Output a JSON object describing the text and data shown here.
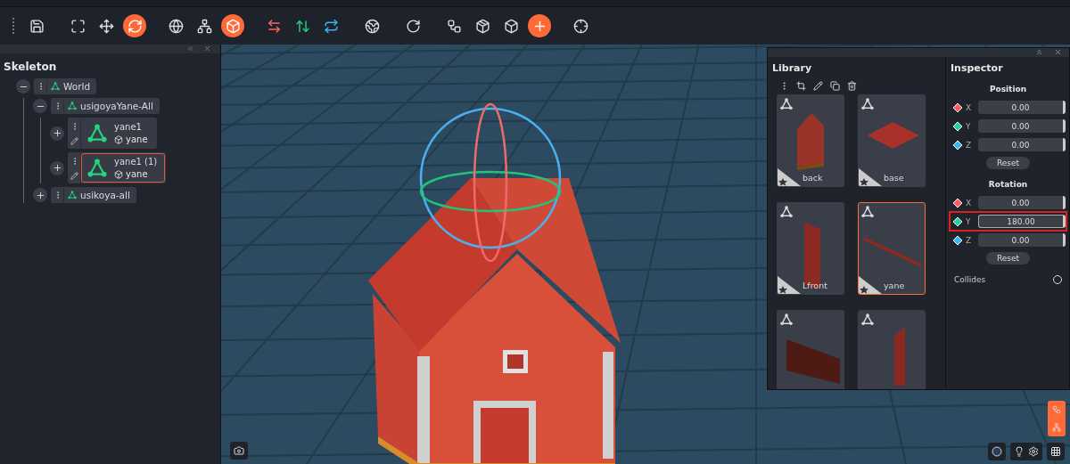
{
  "toolbar": {
    "groups": [
      [
        {
          "active": false
        }
      ],
      [
        {
          "active": false
        },
        {
          "active": false
        },
        {
          "active": true
        }
      ],
      [
        {
          "active": false
        },
        {
          "active": false
        },
        {
          "active": true
        }
      ],
      [
        {
          "active": false
        },
        {
          "active": false
        },
        {
          "active": false
        }
      ],
      [
        {
          "active": false
        }
      ],
      [
        {
          "active": false
        }
      ],
      [
        {
          "active": false
        },
        {
          "active": false
        },
        {
          "active": false
        },
        {
          "active": true
        }
      ],
      [
        {
          "active": false
        }
      ]
    ]
  },
  "skeleton": {
    "title": "Skeleton",
    "tree": [
      {
        "kind": "group",
        "label": "World",
        "expanded": true,
        "selected": false,
        "children": [
          {
            "kind": "group",
            "label": "usigoyaYane-All",
            "expanded": true,
            "selected": false,
            "children": [
              {
                "kind": "model",
                "label": "yane1",
                "model": "yane",
                "expanded": false,
                "selected": false
              },
              {
                "kind": "model",
                "label": "yane1 (1)",
                "model": "yane",
                "expanded": false,
                "selected": true
              }
            ]
          },
          {
            "kind": "group",
            "label": "usikoya-all",
            "expanded": false,
            "selected": false
          }
        ]
      }
    ]
  },
  "library": {
    "title": "Library",
    "items": [
      {
        "label": "back",
        "starred": true,
        "selected": false
      },
      {
        "label": "base",
        "starred": true,
        "selected": false
      },
      {
        "label": "Lfront",
        "starred": true,
        "selected": false
      },
      {
        "label": "yane",
        "starred": true,
        "selected": true
      },
      {
        "starred": false,
        "selected": false
      },
      {
        "starred": false,
        "selected": false
      }
    ]
  },
  "inspector": {
    "title": "Inspector",
    "sections": [
      {
        "title": "Position",
        "fields": [
          {
            "axis": "X",
            "value": "0.00",
            "focused": false
          },
          {
            "axis": "Y",
            "value": "0.00",
            "focused": false
          },
          {
            "axis": "Z",
            "value": "0.00",
            "focused": false
          }
        ],
        "reset": "Reset"
      },
      {
        "title": "Rotation",
        "fields": [
          {
            "axis": "X",
            "value": "0.00",
            "focused": false
          },
          {
            "axis": "Y",
            "value": "180.00",
            "focused": true
          },
          {
            "axis": "Z",
            "value": "0.00",
            "focused": false
          }
        ],
        "reset": "Reset"
      }
    ],
    "collides": {
      "label": "Collides",
      "checked": false
    }
  }
}
